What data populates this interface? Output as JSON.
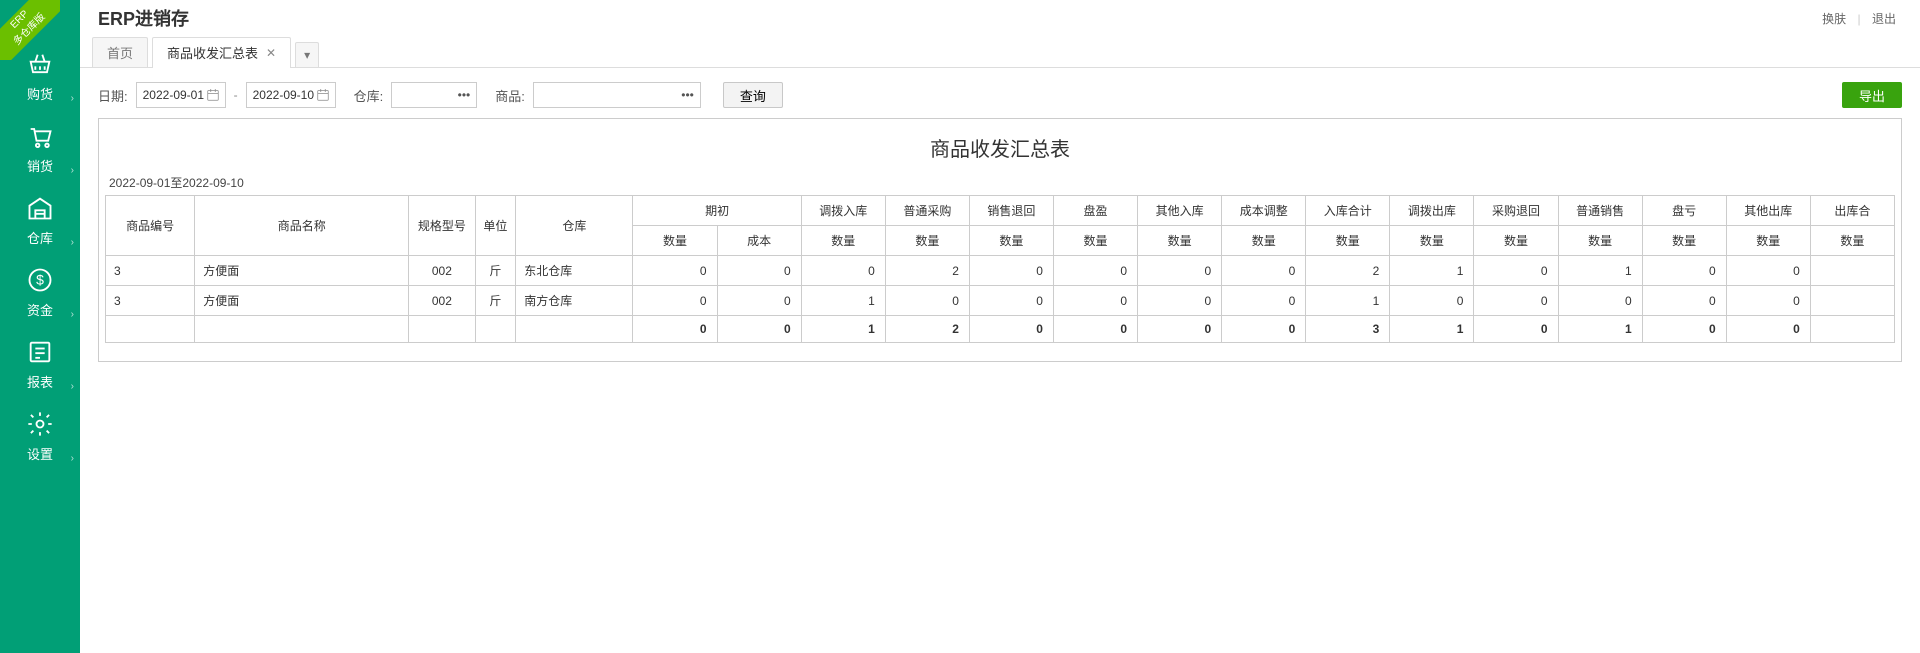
{
  "ribbon": {
    "line1": "ERP",
    "line2": "多仓库版"
  },
  "app_title": "ERP进销存",
  "header_links": {
    "skin": "换肤",
    "logout": "退出"
  },
  "sidebar": [
    {
      "label": "购货",
      "icon": "basket"
    },
    {
      "label": "销货",
      "icon": "cart"
    },
    {
      "label": "仓库",
      "icon": "warehouse"
    },
    {
      "label": "资金",
      "icon": "money"
    },
    {
      "label": "报表",
      "icon": "report"
    },
    {
      "label": "设置",
      "icon": "gear"
    }
  ],
  "tabs": [
    {
      "label": "首页",
      "active": false,
      "closable": false
    },
    {
      "label": "商品收发汇总表",
      "active": true,
      "closable": true
    }
  ],
  "toolbar": {
    "date_label": "日期:",
    "date_from": "2022-09-01",
    "date_to": "2022-09-10",
    "warehouse_label": "仓库:",
    "warehouse_value": "",
    "product_label": "商品:",
    "product_value": "",
    "query_btn": "查询",
    "export_btn": "导出"
  },
  "report": {
    "title": "商品收发汇总表",
    "date_range": "2022-09-01至2022-09-10",
    "header_groups": [
      {
        "label": "商品编号",
        "span": 1,
        "rowspan": 2
      },
      {
        "label": "商品名称",
        "span": 1,
        "rowspan": 2
      },
      {
        "label": "规格型号",
        "span": 1,
        "rowspan": 2
      },
      {
        "label": "单位",
        "span": 1,
        "rowspan": 2
      },
      {
        "label": "仓库",
        "span": 1,
        "rowspan": 2
      },
      {
        "label": "期初",
        "span": 2
      },
      {
        "label": "调拨入库",
        "span": 1
      },
      {
        "label": "普通采购",
        "span": 1
      },
      {
        "label": "销售退回",
        "span": 1
      },
      {
        "label": "盘盈",
        "span": 1
      },
      {
        "label": "其他入库",
        "span": 1
      },
      {
        "label": "成本调整",
        "span": 1
      },
      {
        "label": "入库合计",
        "span": 1
      },
      {
        "label": "调拨出库",
        "span": 1
      },
      {
        "label": "采购退回",
        "span": 1
      },
      {
        "label": "普通销售",
        "span": 1
      },
      {
        "label": "盘亏",
        "span": 1
      },
      {
        "label": "其他出库",
        "span": 1
      },
      {
        "label": "出库合",
        "span": 1
      }
    ],
    "sub_headers": [
      "数量",
      "成本",
      "数量",
      "数量",
      "数量",
      "数量",
      "数量",
      "数量",
      "数量",
      "数量",
      "数量",
      "数量",
      "数量",
      "数量",
      "数量"
    ],
    "rows": [
      {
        "id": "3",
        "name": "方便面",
        "spec": "002",
        "unit": "斤",
        "wh": "东北仓库",
        "vals": [
          0,
          0,
          0,
          2,
          0,
          0,
          0,
          0,
          2,
          1,
          0,
          1,
          0,
          0,
          ""
        ]
      },
      {
        "id": "3",
        "name": "方便面",
        "spec": "002",
        "unit": "斤",
        "wh": "南方仓库",
        "vals": [
          0,
          0,
          1,
          0,
          0,
          0,
          0,
          0,
          1,
          0,
          0,
          0,
          0,
          0,
          ""
        ]
      }
    ],
    "totals": [
      "",
      "",
      "",
      "",
      "",
      0,
      0,
      1,
      2,
      0,
      0,
      0,
      0,
      3,
      1,
      0,
      1,
      0,
      0,
      ""
    ]
  }
}
